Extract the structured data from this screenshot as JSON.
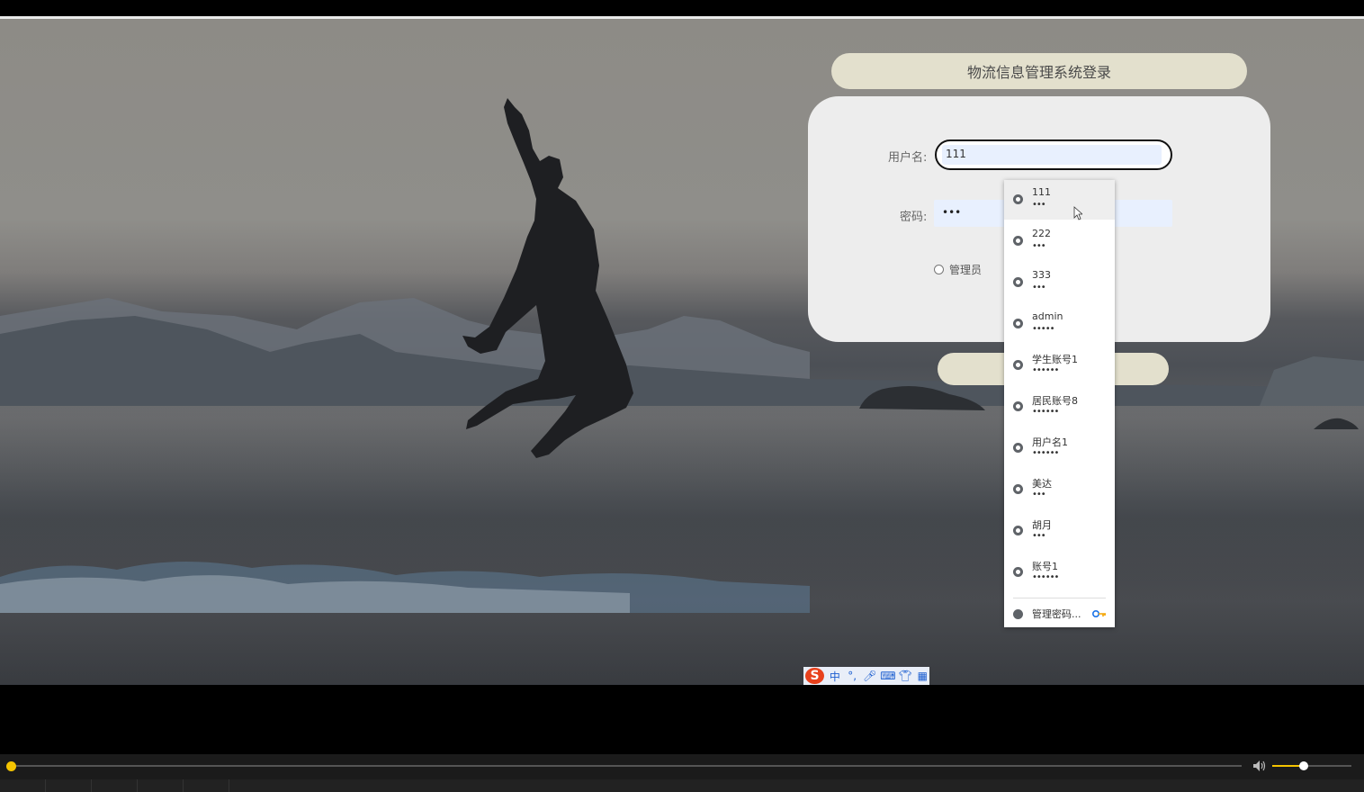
{
  "login": {
    "title": "物流信息管理系统登录",
    "username_label": "用户名:",
    "username_value": "111",
    "password_label": "密码:",
    "password_value": "•••",
    "role_option": "管理员"
  },
  "autofill": {
    "items": [
      {
        "user": "111",
        "pass": "•••"
      },
      {
        "user": "222",
        "pass": "•••"
      },
      {
        "user": "333",
        "pass": "•••"
      },
      {
        "user": "admin",
        "pass": "•••••"
      },
      {
        "user": "学生账号1",
        "pass": "••••••"
      },
      {
        "user": "居民账号8",
        "pass": "••••••"
      },
      {
        "user": "用户名1",
        "pass": "••••••"
      },
      {
        "user": "美达",
        "pass": "•••"
      },
      {
        "user": "胡月",
        "pass": "•••"
      },
      {
        "user": "账号1",
        "pass": "••••••"
      }
    ],
    "manage_label": "管理密码..."
  },
  "ime": {
    "logo": "S",
    "mode": "中",
    "punct": "°,"
  },
  "player": {
    "progress": 0.0,
    "volume": 0.4
  },
  "colors": {
    "accent": "#f4c400",
    "pill": "#e3e0cd",
    "card": "#ededed",
    "autofill": "#e8f0fe"
  }
}
